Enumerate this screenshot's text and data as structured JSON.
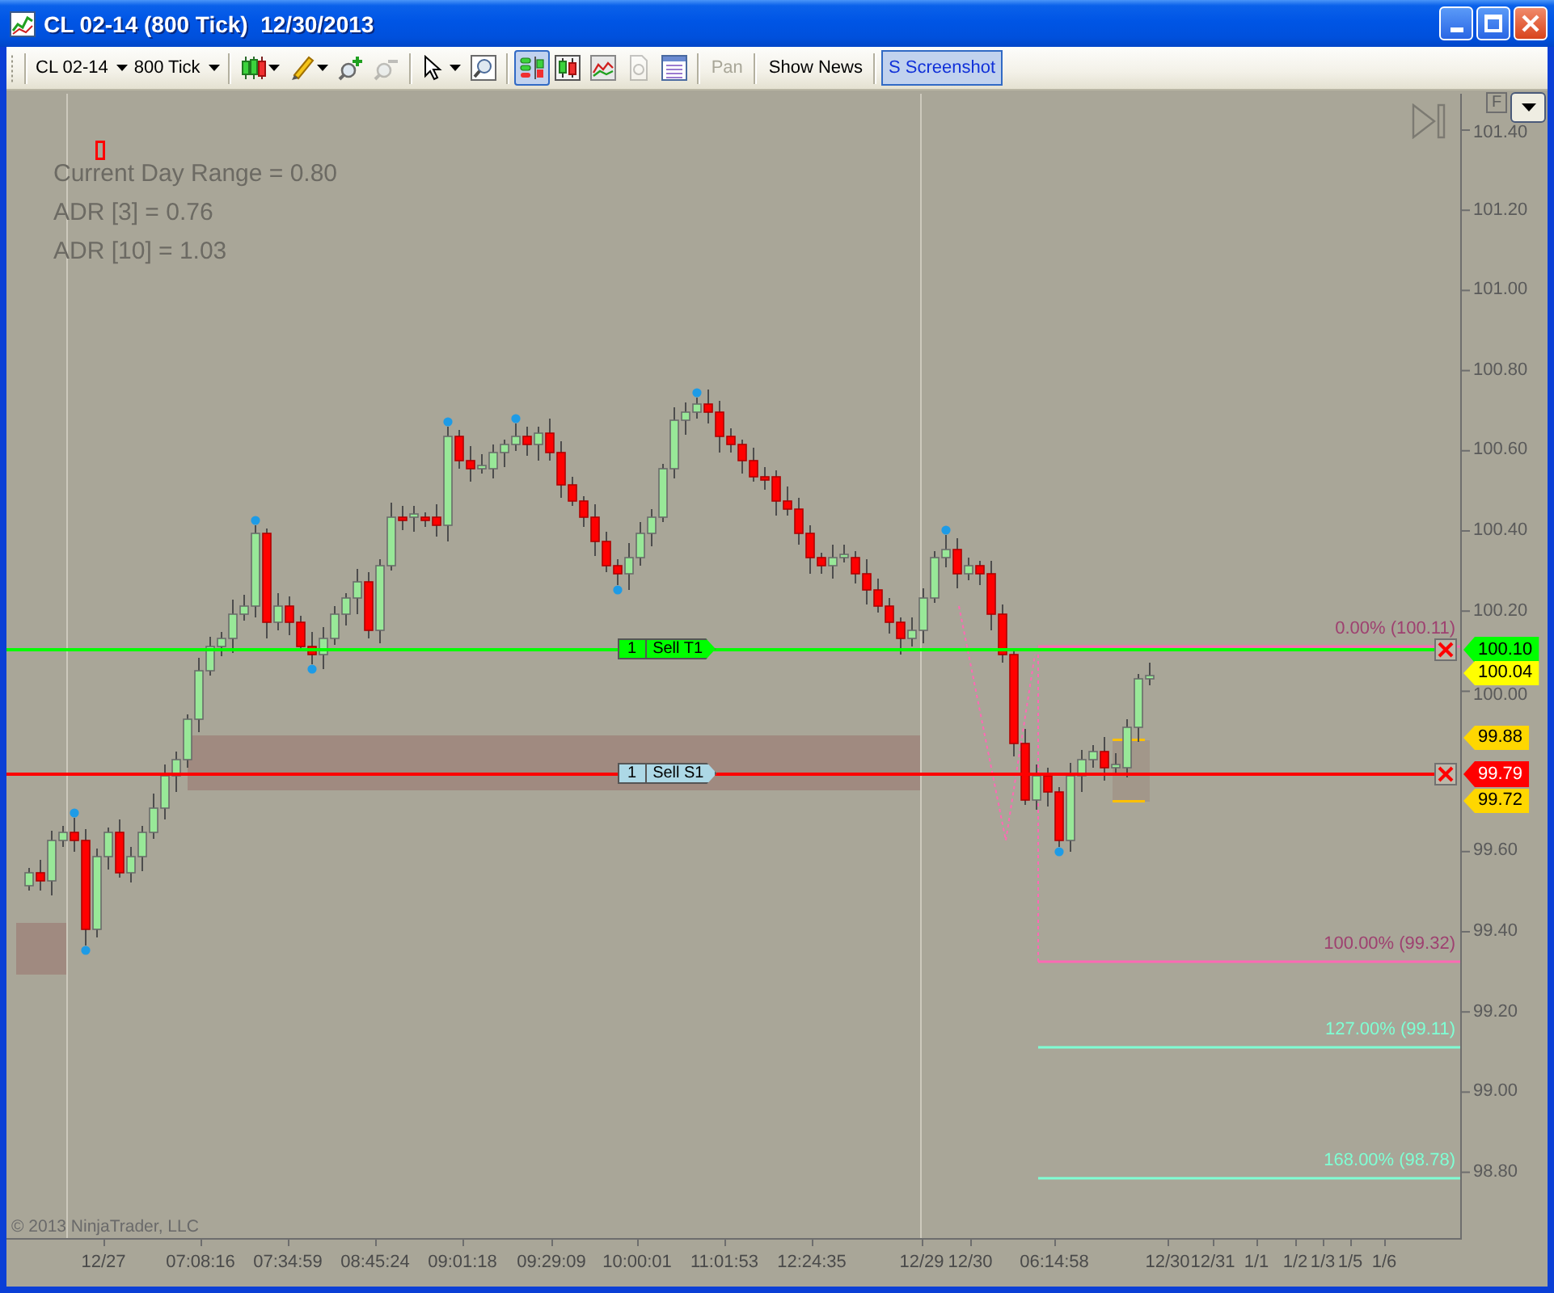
{
  "window": {
    "title": "CL 02-14 (800 Tick)  12/30/2013"
  },
  "toolbar": {
    "dropdowns": [
      {
        "label": "CL 02-14"
      },
      {
        "label": "800 Tick"
      }
    ],
    "tools": [
      {
        "selected": false,
        "disabled": false
      },
      {
        "selected": false,
        "disabled": false
      },
      {
        "selected": false,
        "disabled": false
      },
      {
        "selected": false,
        "disabled": true
      },
      {
        "selected": false,
        "disabled": false
      },
      {
        "selected": false,
        "disabled": false
      },
      {
        "selected": true,
        "disabled": false
      },
      {
        "selected": false,
        "disabled": false
      },
      {
        "selected": false,
        "disabled": false
      },
      {
        "selected": false,
        "disabled": true
      },
      {
        "selected": false,
        "disabled": false
      }
    ],
    "text_buttons": [
      {
        "label": "Pan",
        "selected": false,
        "disabled": true
      },
      {
        "label": "Show News",
        "selected": false,
        "disabled": false
      },
      {
        "label": "S Screenshot",
        "selected": true,
        "disabled": false
      }
    ]
  },
  "chart": {
    "info_lines": [
      "Current Day Range = 0.80",
      "ADR [3] = 0.76",
      "ADR [10] = 1.03"
    ],
    "corner_button": {
      "label": "F"
    },
    "orders": [
      {
        "kind": "target",
        "quantity": "1",
        "label": "Sell T1",
        "price": "100.10"
      },
      {
        "kind": "stop",
        "quantity": "1",
        "label": "Sell S1",
        "price": "99.79"
      }
    ],
    "price_flags": [
      {
        "price": "100.04",
        "color": "#ffff00"
      },
      {
        "price": "99.88",
        "color": "#ffd700"
      },
      {
        "price": "99.72",
        "color": "#ffd700"
      }
    ],
    "fib_levels": [
      {
        "label": "0.00% (100.11)",
        "color": "#ff69b4"
      },
      {
        "label": "100.00% (99.32)",
        "color": "#ff69b4"
      },
      {
        "label": "127.00% (99.11)",
        "color": "#7fffd4"
      },
      {
        "label": "168.00% (98.78)",
        "color": "#7fffd4"
      }
    ],
    "price_axis": {
      "labels": [
        "101.40",
        "101.20",
        "101.00",
        "100.80",
        "100.60",
        "100.40",
        "100.20",
        "100.00",
        "99.60",
        "99.40",
        "99.20",
        "99.00",
        "98.80"
      ]
    },
    "time_axis": {
      "labels": [
        "12/27",
        "07:08:16",
        "07:34:59",
        "08:45:24",
        "09:01:18",
        "09:29:09",
        "10:00:01",
        "11:01:53",
        "12:24:35",
        "12/29",
        "12/30",
        "06:14:58",
        "12/30",
        "12/31",
        "1/1",
        "1/2",
        "1/3",
        "1/5",
        "1/6"
      ]
    },
    "copyright": "© 2013 NinjaTrader, LLC"
  }
}
